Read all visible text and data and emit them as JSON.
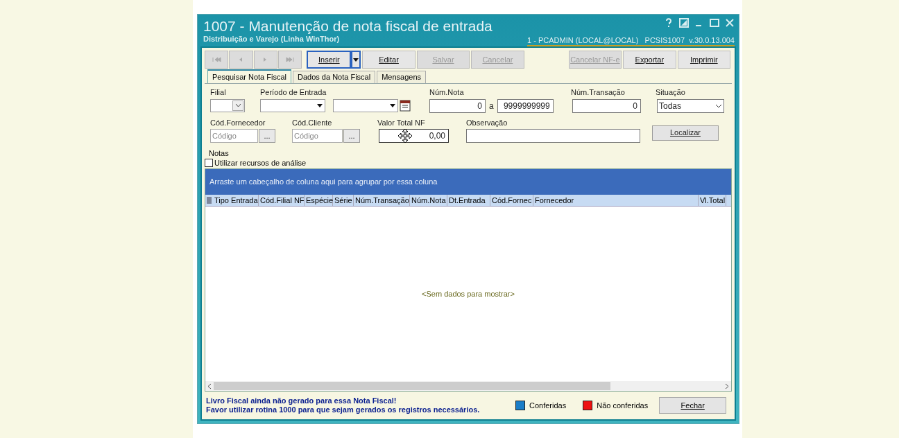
{
  "window": {
    "title": "1007 - Manutenção de nota fiscal de entrada",
    "subtitle": "Distribuição e Varejo (Linha WinThor)",
    "session": "1 - PCADMIN (LOCAL@LOCAL)   PCSIS1007  v.30.0.13.004"
  },
  "toolbar": {
    "nav": [
      {
        "disabled": true
      },
      {
        "disabled": true
      },
      {
        "disabled": true
      },
      {
        "disabled": true
      }
    ],
    "buttons": [
      {
        "label": "Inserir",
        "kind": "split",
        "disabled": false,
        "focused": true
      },
      {
        "label": "Editar",
        "kind": "plain",
        "disabled": false,
        "focused": false
      },
      {
        "label": "Salvar",
        "kind": "plain",
        "disabled": true,
        "focused": false
      },
      {
        "label": "Cancelar",
        "kind": "plain",
        "disabled": true,
        "focused": false
      },
      {
        "label": "Cancelar NF-e",
        "kind": "spaced",
        "disabled": true,
        "focused": false
      },
      {
        "label": "Exportar",
        "kind": "plain",
        "disabled": false,
        "focused": false
      },
      {
        "label": "Imprimir",
        "kind": "plain",
        "disabled": false,
        "focused": false
      }
    ]
  },
  "tabs": [
    {
      "label": "Pesquisar Nota Fiscal",
      "selected": true
    },
    {
      "label": "Dados da Nota Fiscal",
      "selected": false
    },
    {
      "label": "Mensagens",
      "selected": false
    }
  ],
  "filters": {
    "filial": {
      "label": "Filial"
    },
    "periodo": {
      "label": "Período de Entrada"
    },
    "num_nota": {
      "label": "Núm.Nota",
      "from": "0",
      "separator": "a",
      "to": "9999999999"
    },
    "num_transacao": {
      "label": "Núm.Transação",
      "value": "0"
    },
    "situacao": {
      "label": "Situação",
      "value": "Todas"
    },
    "fornecedor": {
      "label": "Cód.Fornecedor",
      "placeholder": "Código",
      "button": "..."
    },
    "cliente": {
      "label": "Cód.Cliente",
      "placeholder": "Código",
      "button": "..."
    },
    "valor_total": {
      "label": "Valor Total NF",
      "value": "0,00"
    },
    "observacao": {
      "label": "Observação"
    },
    "search_button": "Localizar"
  },
  "notas": {
    "label": "Notas",
    "analysis_checkbox": {
      "label": "Utilizar recursos de análise",
      "checked": false
    }
  },
  "grid": {
    "group_hint": "Arraste um cabeçalho de coluna aqui para agrupar por essa coluna",
    "columns": [
      "Tipo Entrada",
      "Cód.Filial NF",
      "Espécie",
      "Série",
      "Núm.Transação",
      "Núm.Nota",
      "Dt.Entrada",
      "Cód.Fornec",
      "Fornecedor",
      "Vl.Total"
    ],
    "empty_text": "<Sem dados para mostrar>"
  },
  "footer": {
    "messages": [
      "Livro Fiscal ainda não gerado para essa Nota Fiscal!",
      "Favor utilizar rotina 1000 para que sejam gerados os registros necessários."
    ],
    "legend": [
      {
        "label": "Conferidas",
        "color": "#1a7dc8"
      },
      {
        "label": "Não conferidas",
        "color": "#ee1111"
      }
    ],
    "close_button": "Fechar"
  }
}
